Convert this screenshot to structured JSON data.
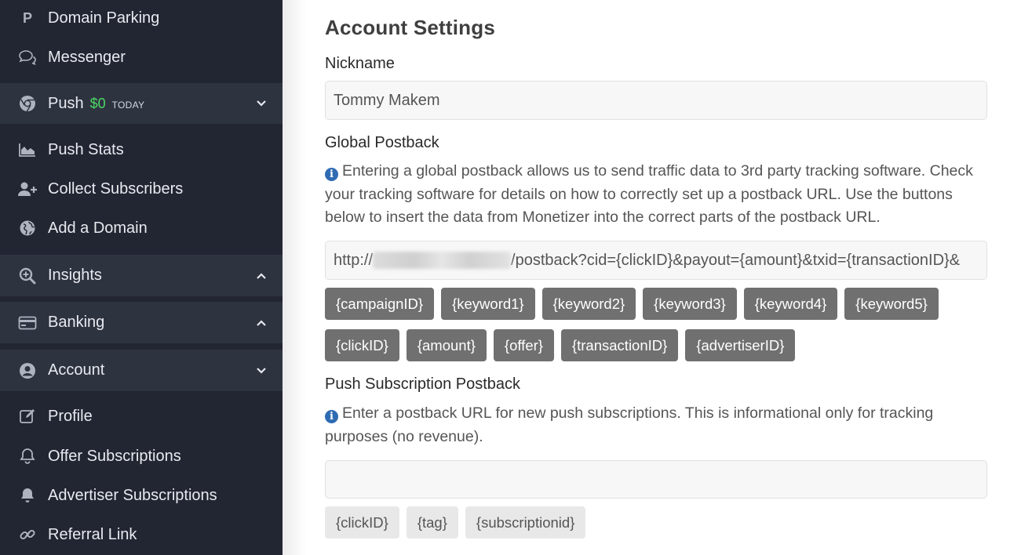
{
  "sidebar": {
    "items": [
      {
        "label": "Domain Parking",
        "icon": "p-letter-icon"
      },
      {
        "label": "Messenger",
        "icon": "chat-bubbles-icon"
      }
    ],
    "push": {
      "label": "Push",
      "amount": "$0",
      "period": "TODAY"
    },
    "push_items": [
      {
        "label": "Push Stats"
      },
      {
        "label": "Collect Subscribers"
      },
      {
        "label": "Add a Domain"
      }
    ],
    "insights": {
      "label": "Insights"
    },
    "banking": {
      "label": "Banking"
    },
    "account": {
      "label": "Account"
    },
    "account_items": [
      {
        "label": "Profile"
      },
      {
        "label": "Offer Subscriptions"
      },
      {
        "label": "Advertiser Subscriptions"
      },
      {
        "label": "Referral Link"
      }
    ]
  },
  "main": {
    "title": "Account Settings",
    "nickname": {
      "label": "Nickname",
      "value": "Tommy Makem"
    },
    "global_postback": {
      "label": "Global Postback",
      "help": "Entering a global postback allows us to send traffic data to 3rd party tracking software. Check your tracking software for details on how to correctly set up a postback URL. Use the buttons below to insert the data from Monetizer into the correct parts of the postback URL.",
      "value_prefix": "http://",
      "value_suffix": "/postback?cid={clickID}&payout={amount}&txid={transactionID}&",
      "buttons_row1": [
        "{campaignID}",
        "{keyword1}",
        "{keyword2}",
        "{keyword3}",
        "{keyword4}",
        "{keyword5}"
      ],
      "buttons_row2": [
        "{clickID}",
        "{amount}",
        "{offer}",
        "{transactionID}",
        "{advertiserID}"
      ]
    },
    "push_postback": {
      "label": "Push Subscription Postback",
      "help": "Enter a postback URL for new push subscriptions. This is informational only for tracking purposes (no revenue).",
      "value": "",
      "buttons": [
        "{clickID}",
        "{tag}",
        "{subscriptionid}"
      ]
    }
  },
  "colors": {
    "sidebar_bg": "#222632",
    "section_bg": "#2e3340",
    "money_green": "#4cd964",
    "button_dark": "#707070",
    "button_light": "#e8e8e8",
    "info_blue": "#2f6bb3"
  }
}
